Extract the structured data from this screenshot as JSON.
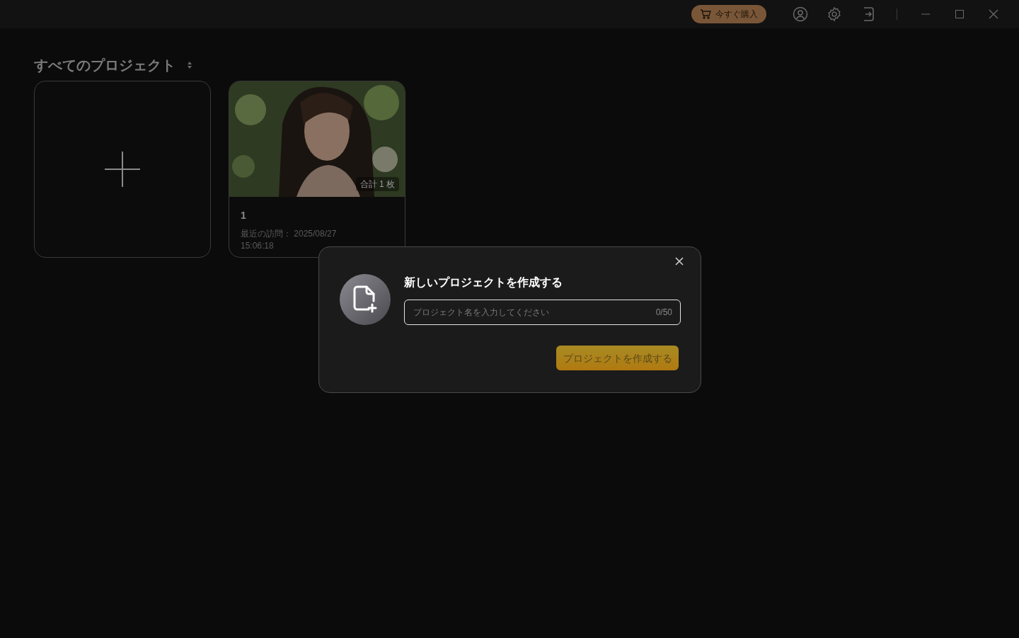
{
  "title_bar": {
    "buy_button": "今すぐ購入"
  },
  "heading": "すべてのプロジェクト",
  "projects": [
    {
      "kind": "new"
    },
    {
      "kind": "project",
      "count": "合計 1 枚",
      "name": "1",
      "visited": "最近の訪問：  2025/08/27 15:06:18"
    }
  ],
  "dialog": {
    "title": "新しいプロジェクトを作成する",
    "input": {
      "placeholder": "プロジェクト名を入力してください",
      "counter": "0/50"
    },
    "create_button": {
      "label": "プロジェクトを作成する",
      "disabled": true
    }
  }
}
